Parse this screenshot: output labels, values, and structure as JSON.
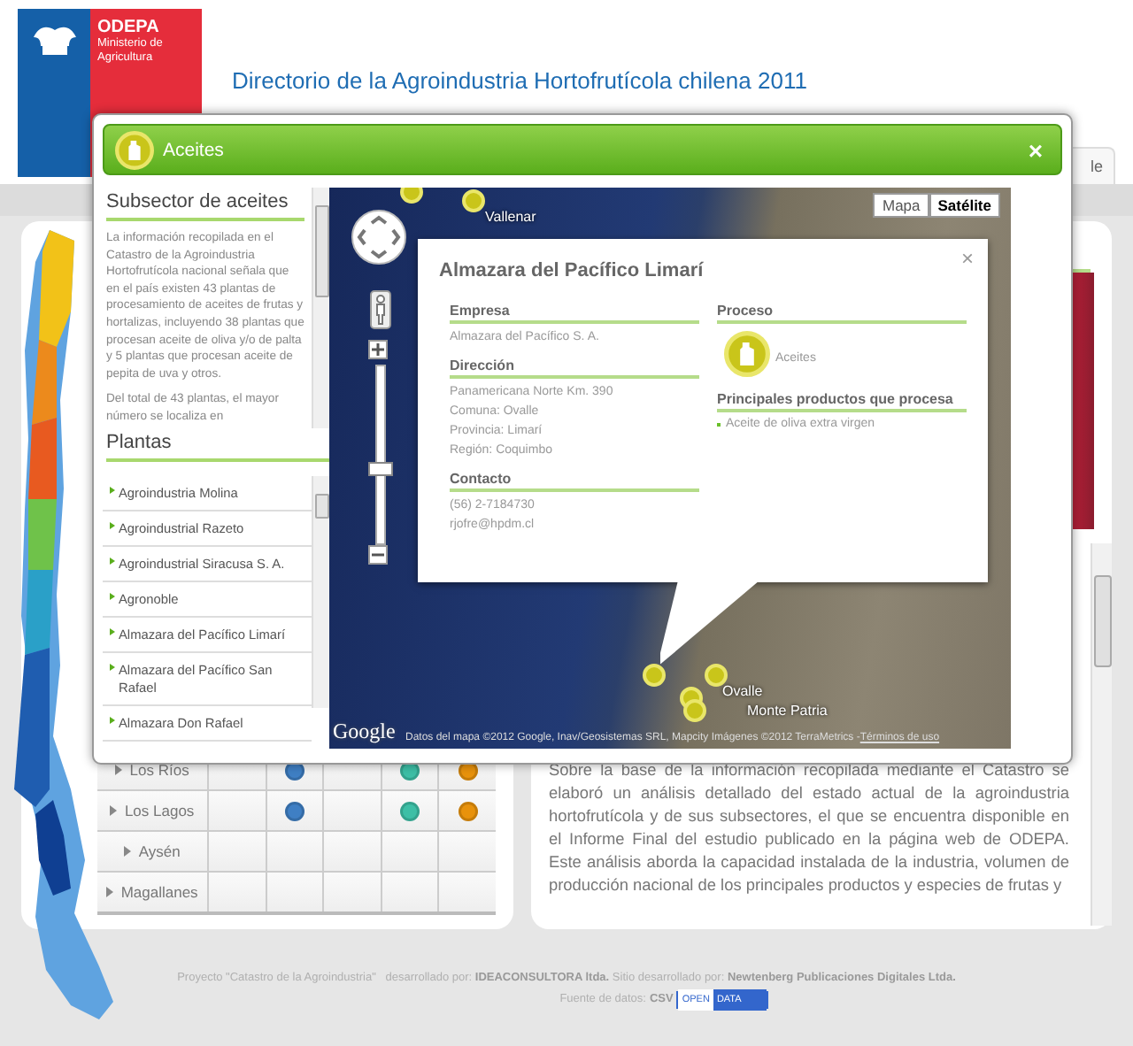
{
  "header": {
    "logo": {
      "name": "ODEPA",
      "subtitle": "Ministerio de Agricultura"
    },
    "title": "Directorio de la Agroindustria Hortofrutícola chilena 2011"
  },
  "background_tab": {
    "label": "le"
  },
  "region_table": {
    "rows": [
      {
        "region": "Los Ríos",
        "cells": [
          {
            "dot": false
          },
          {
            "dot": true,
            "color": "#3f7fc4"
          },
          {
            "dot": false
          },
          {
            "dot": true,
            "color": "#3dbfa6"
          },
          {
            "dot": true,
            "color": "#e8920c"
          }
        ]
      },
      {
        "region": "Los Lagos",
        "cells": [
          {
            "dot": false
          },
          {
            "dot": true,
            "color": "#3f7fc4"
          },
          {
            "dot": false
          },
          {
            "dot": true,
            "color": "#3dbfa6"
          },
          {
            "dot": true,
            "color": "#e8920c"
          }
        ]
      },
      {
        "region": "Aysén",
        "cells": [
          {
            "dot": false
          },
          {
            "dot": false
          },
          {
            "dot": false
          },
          {
            "dot": false
          },
          {
            "dot": false
          }
        ]
      },
      {
        "region": "Magallanes",
        "cells": [
          {
            "dot": false
          },
          {
            "dot": false
          },
          {
            "dot": false
          },
          {
            "dot": false
          },
          {
            "dot": false
          }
        ]
      }
    ]
  },
  "article": {
    "text": "Sobre la base de la información recopilada mediante el Catastro se elaboró un análisis detallado del estado actual de la agroindustria hortofrutícola y de sus subsectores, el que se encuentra disponible en el Informe Final del estudio publicado en la página web de ODEPA. Este análisis aborda la capacidad instalada de la industria, volumen de producción nacional de los principales productos y especies de frutas y"
  },
  "footer": {
    "credits": "Proyecto \"Catastro de la Agroindustria\"   desarrollado por: **IDEACONSULTORA ltda.** Sitio desarrollado por: **Newtenberg Publicaciones Digitales Ltda.**",
    "source_label": "Fuente de datos:",
    "source_link": "CSV",
    "badge": [
      "OPEN",
      "DATA"
    ]
  },
  "modal": {
    "title": "Aceites",
    "close": "×",
    "subsector": {
      "heading": "Subsector de aceites",
      "paragraphs": [
        "La información recopilada en el Catastro de la Agroindustria Hortofrutícola nacional señala que en el país existen 43 plantas de procesamiento de aceites de frutas y hortalizas, incluyendo 38 plantas que procesan aceite de oliva y/o de palta y 5 plantas que procesan aceite de pepita de uva y otros.",
        "Del total de 43 plantas, el mayor número se localiza en"
      ]
    },
    "plantas": {
      "heading": "Plantas",
      "items": [
        "Agroindustria Molina",
        "Agroindustrial Razeto",
        "Agroindustrial Siracusa S. A.",
        "Agronoble",
        "Almazara del Pacífico Limarí",
        "Almazara del Pacífico San Rafael",
        "Almazara Don Rafael"
      ]
    },
    "map": {
      "type_buttons": [
        {
          "label": "Mapa",
          "selected": false
        },
        {
          "label": "Satélite",
          "selected": true
        }
      ],
      "zoom": {
        "level": 0.43
      },
      "place_labels": [
        "Vallenar",
        "Ovalle",
        "Monte Patria"
      ],
      "logo": "Google",
      "attribution": "Datos del mapa ©2012 Google, Inav/Geosistemas SRL, Mapcity Imágenes ©2012 TerraMetrics - ",
      "terms_link": "Términos de uso",
      "info_window": {
        "title": "Almazara del Pacífico Limarí",
        "close": "×",
        "left": [
          {
            "heading": "Empresa",
            "lines": [
              "Almazara del Pacífico S. A."
            ]
          },
          {
            "heading": "Dirección",
            "lines": [
              "Panamericana Norte Km. 390",
              "Comuna: Ovalle",
              "Provincia: Limarí",
              "Región: Coquimbo"
            ]
          },
          {
            "heading": "Contacto",
            "lines": [
              "(56) 2-7184730",
              "rjofre@hpdm.cl"
            ]
          }
        ],
        "process": {
          "heading": "Proceso",
          "label": "Aceites"
        },
        "products": {
          "heading": "Principales productos que procesa",
          "items": [
            "Aceite de oliva extra virgen"
          ]
        }
      }
    }
  }
}
